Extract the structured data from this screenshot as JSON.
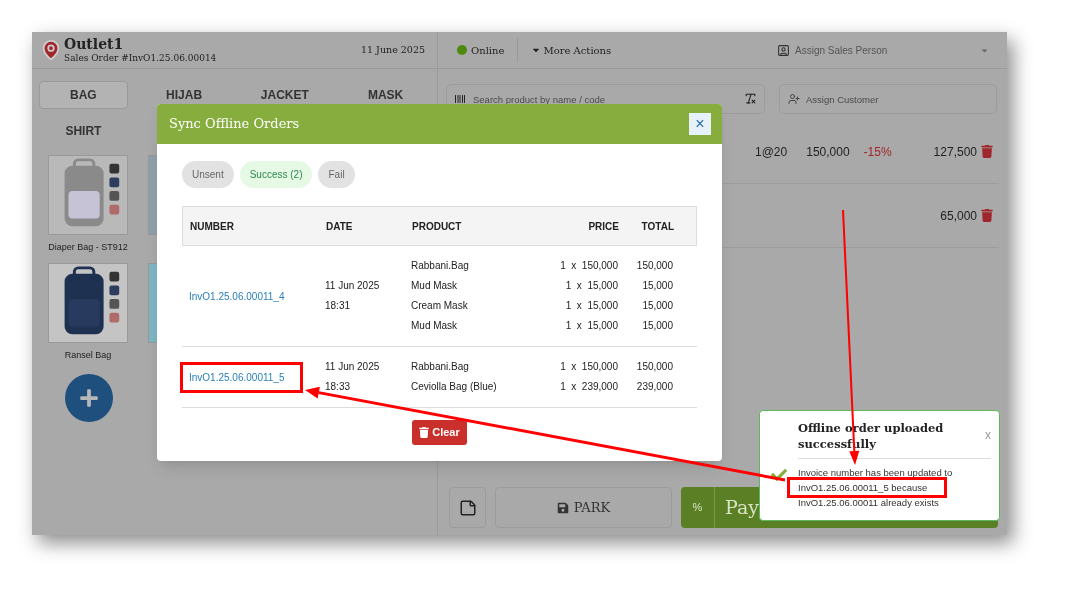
{
  "header": {
    "outlet": "Outlet1",
    "order": "Sales Order #InvO1.25.06.00014",
    "date": "11 June 2025"
  },
  "status": {
    "label": "Online",
    "online": true
  },
  "more_actions": "More Actions",
  "sales_person": {
    "placeholder": "Assign Sales Person"
  },
  "categories": [
    {
      "label": "BAG",
      "selected": true
    },
    {
      "label": "HIJAB",
      "selected": false
    },
    {
      "label": "JACKET",
      "selected": false
    },
    {
      "label": "MASK",
      "selected": false
    },
    {
      "label": "SHIRT",
      "selected": false
    }
  ],
  "products": [
    {
      "kind": "picture",
      "name": "Diaper Bag - ST912"
    },
    {
      "kind": "picture"
    },
    {
      "kind": "picture",
      "name": "Ransel Bag"
    },
    {
      "kind": "picture"
    }
  ],
  "search": {
    "placeholder": "Search product by name / code"
  },
  "customer": {
    "placeholder": "Assign Customer"
  },
  "cart": [
    {
      "qty": "1@20",
      "price": "150,000",
      "discount": "-15%",
      "total": "127,500"
    },
    {
      "total": "65,000"
    }
  ],
  "bottom": {
    "park": "PARK",
    "discount": "%",
    "pay": "Pay"
  },
  "modal": {
    "title": "Sync Offline Orders",
    "close": "×",
    "filters": [
      {
        "label": "Unsent",
        "selected": false
      },
      {
        "label": "Success (2)",
        "selected": true
      },
      {
        "label": "Fail",
        "selected": false
      }
    ],
    "columns": [
      "NUMBER",
      "DATE",
      "PRODUCT",
      "PRICE",
      "TOTAL"
    ],
    "orders": [
      {
        "number": "InvO1.25.06.00011_4",
        "date": "11 Jun 2025",
        "time": "18:31",
        "highlighted": false,
        "items": [
          {
            "product": "Rabbani.Bag",
            "price": "1  x  150,000",
            "total": "150,000"
          },
          {
            "product": "Mud Mask",
            "price": "1  x  15,000",
            "total": "15,000"
          },
          {
            "product": "Cream Mask",
            "price": "1  x  15,000",
            "total": "15,000"
          },
          {
            "product": "Mud Mask",
            "price": "1  x  15,000",
            "total": "15,000"
          }
        ]
      },
      {
        "number": "InvO1.25.06.00011_5",
        "date": "11 Jun 2025",
        "time": "18:33",
        "highlighted": true,
        "items": [
          {
            "product": "Rabbani.Bag",
            "price": "1  x  150,000",
            "total": "150,000"
          },
          {
            "product": "Ceviolla Bag (Blue)",
            "price": "1  x  239,000",
            "total": "239,000"
          }
        ]
      }
    ],
    "clear": "Clear"
  },
  "toast": {
    "title": "Offline order uploaded successfully",
    "close": "x",
    "lines": [
      {
        "text": "Invoice number has been updated to",
        "highlighted": false
      },
      {
        "text": "InvO1.25.06.00011_5 because",
        "highlighted": true
      },
      {
        "text": "InvO1.25.06.00011 already exists",
        "highlighted": false
      }
    ]
  }
}
